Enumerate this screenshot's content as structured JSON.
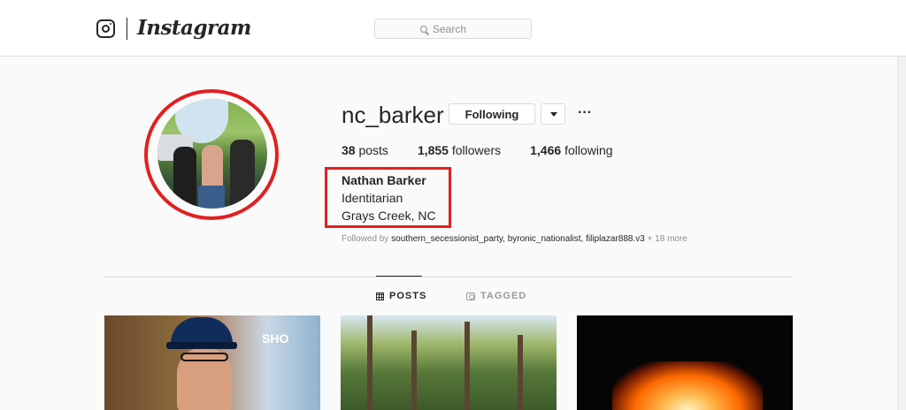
{
  "nav": {
    "wordmark": "Instagram",
    "search_placeholder": "Search"
  },
  "profile": {
    "username": "nc_barker",
    "follow_button": "Following",
    "more_glyph": "···",
    "stats": {
      "posts_count": "38",
      "posts_label": "posts",
      "followers_count": "1,855",
      "followers_label": "followers",
      "following_count": "1,466",
      "following_label": "following"
    },
    "bio": {
      "full_name": "Nathan Barker",
      "line1": "Identitarian",
      "line2": "Grays Creek, NC"
    },
    "followed_by": {
      "prefix": "Followed by",
      "accounts": "southern_secessionist_party, byronic_nationalist, filiplazar888.v3",
      "more": "+ 18 more"
    }
  },
  "tabs": {
    "posts": "POSTS",
    "tagged": "TAGGED"
  },
  "posts": {
    "post1_sign": "SHO"
  },
  "colors": {
    "highlight_annotation": "#e02020",
    "border": "#dbdbdb",
    "text": "#262626",
    "muted": "#8e8e8e"
  }
}
